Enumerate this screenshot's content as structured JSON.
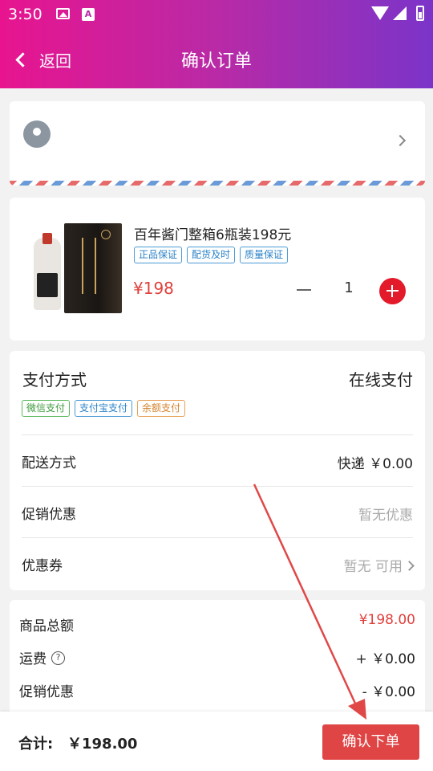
{
  "status_bar": {
    "time": "3:50",
    "icons": [
      "image-icon",
      "text-a-icon",
      "wifi-icon",
      "signal-icon",
      "battery-icon"
    ]
  },
  "header": {
    "back_label": "返回",
    "title": "确认订单",
    "gradient": [
      "#e8148f",
      "#7b34c9"
    ]
  },
  "address": {
    "icon": "location-pin-icon"
  },
  "product": {
    "name": "百年酱门整箱6瓶装198元",
    "tags": [
      "正品保证",
      "配货及时",
      "质量保证"
    ],
    "price": "¥198",
    "quantity": "1"
  },
  "payment": {
    "label": "支付方式",
    "value": "在线支付",
    "options": [
      "微信支付",
      "支付宝支付",
      "余额支付"
    ]
  },
  "rows": {
    "delivery": {
      "label": "配送方式",
      "value": "快递 ￥0.00"
    },
    "promotion": {
      "label": "促销优惠",
      "value": "暂无优惠"
    },
    "coupon": {
      "label": "优惠券",
      "value": "暂无 可用"
    }
  },
  "summary": {
    "goods_total_label": "商品总额",
    "goods_total_value": "¥198.00",
    "shipping_label": "运费",
    "shipping_help": "?",
    "shipping_value": "+ ￥0.00",
    "promo_label": "促销优惠",
    "promo_value": "- ￥0.00"
  },
  "footer": {
    "total_label": "合计:",
    "total_value": "￥198.00",
    "submit_label": "确认下单"
  },
  "colors": {
    "accent_red": "#e0403c",
    "submit_button": "#e04545",
    "annotation_arrow": "#e04848"
  }
}
